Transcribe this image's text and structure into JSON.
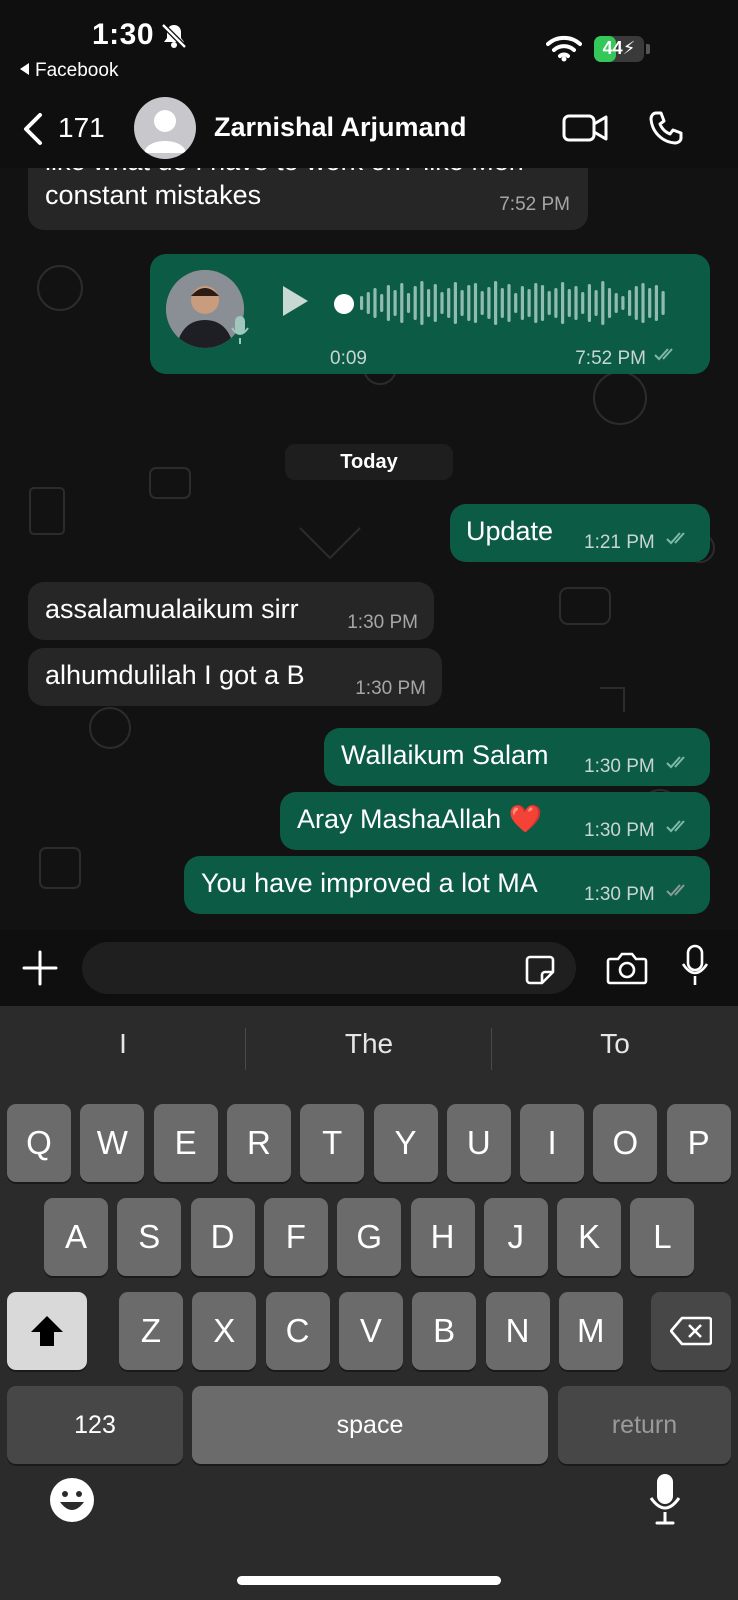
{
  "status_bar": {
    "time": "1:30",
    "back_app": "Facebook",
    "battery": "44",
    "battery_level_percent": 44
  },
  "header": {
    "unread_count": "171",
    "contact_name": "Zarnishal Arjumand"
  },
  "messages": [
    {
      "direction": "in",
      "text": "like what do I have to work on? like Meri",
      "text2": "constant mistakes",
      "time": "7:52 PM"
    },
    {
      "direction": "out",
      "type": "voice",
      "duration": "0:09",
      "time": "7:52 PM"
    },
    {
      "type": "date",
      "text": "Today"
    },
    {
      "direction": "out",
      "text": "Update",
      "time": "1:21 PM"
    },
    {
      "direction": "in",
      "text": "assalamualaikum sirr",
      "time": "1:30 PM"
    },
    {
      "direction": "in",
      "text": "alhumdulilah I got a B",
      "time": "1:30 PM"
    },
    {
      "direction": "out",
      "text": "Wallaikum Salam",
      "time": "1:30 PM"
    },
    {
      "direction": "out",
      "text": "Aray MashaAllah ❤️",
      "time": "1:30 PM"
    },
    {
      "direction": "out",
      "text": "You have improved a lot MA",
      "time": "1:30 PM"
    }
  ],
  "input": {
    "value": "",
    "placeholder": ""
  },
  "keyboard": {
    "suggestions": [
      "I",
      "The",
      "To"
    ],
    "row1": [
      "Q",
      "W",
      "E",
      "R",
      "T",
      "Y",
      "U",
      "I",
      "O",
      "P"
    ],
    "row2": [
      "A",
      "S",
      "D",
      "F",
      "G",
      "H",
      "J",
      "K",
      "L"
    ],
    "row3": [
      "Z",
      "X",
      "C",
      "V",
      "B",
      "N",
      "M"
    ],
    "numbers_label": "123",
    "space_label": "space",
    "return_label": "return"
  },
  "icons": {
    "bell": "bell-slash-icon",
    "wifi": "wifi-icon",
    "back": "chevron-left-icon",
    "video": "video-camera-icon",
    "phone": "phone-icon",
    "plus": "plus-icon",
    "sticker": "sticker-icon",
    "camera": "camera-icon",
    "mic": "microphone-icon",
    "emoji": "emoji-icon",
    "shift": "shift-icon",
    "delete": "delete-icon"
  },
  "colors": {
    "outgoing_bubble": "#0b5b45",
    "incoming_bubble": "#262626",
    "battery": "#34c759",
    "read_ticks": "#7fb8a8"
  }
}
